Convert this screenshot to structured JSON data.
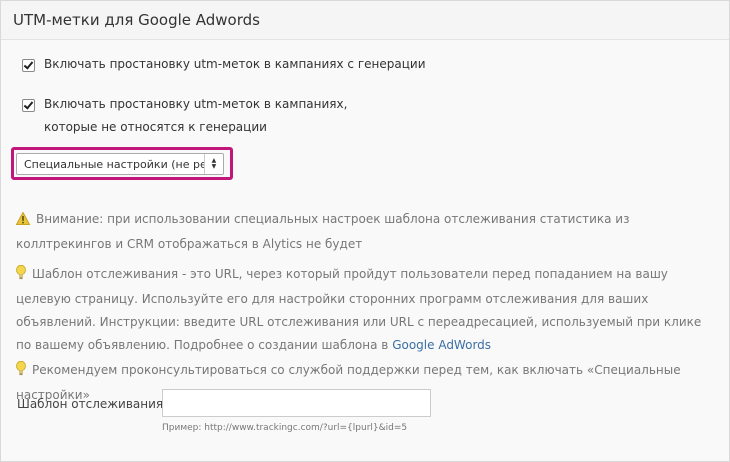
{
  "panel": {
    "title": "UTM-метки для Google Adwords"
  },
  "options": {
    "utm_generation": {
      "label": "Включать простановку utm-меток в кампаниях с генерации",
      "checked": true
    },
    "utm_non_generation": {
      "label": "Включать простановку utm-меток в кампаниях, которые не относятся к генерации",
      "checked": true
    }
  },
  "settings_select": {
    "selected": "Специальные настройки (не рек..."
  },
  "warning": {
    "text": "Внимание: при использовании специальных настроек шаблона отслеживания статистика из коллтрекингов и CRM отображаться в Alytics не будет",
    "icon": "warning-triangle-icon"
  },
  "template_info": {
    "text": "Шаблон отслеживания - это URL, через который пройдут пользователи перед попаданием на вашу целевую страницу. Используйте его для настройки сторонних программ отслеживания для ваших объявлений. Инструкции: введите URL отслеживания или URL с переадресацией, используемый при клике по вашему объявлению. Подробнее о создании шаблона в ",
    "link": "Google AdWords",
    "icon": "lightbulb-icon"
  },
  "recommendation": {
    "text": "Рекомендуем проконсультироваться со службой поддержки перед тем, как включать «Специальные настройки»",
    "icon": "lightbulb-icon"
  },
  "tracking_template": {
    "label": "Шаблон отслеживания",
    "value": "",
    "hint": "Пример: http://www.trackingc.com/?url={lpurl}&id=5"
  },
  "colors": {
    "highlight": "#c2177a",
    "warning_icon": "#e8c53a",
    "link": "#3a6ea5"
  }
}
